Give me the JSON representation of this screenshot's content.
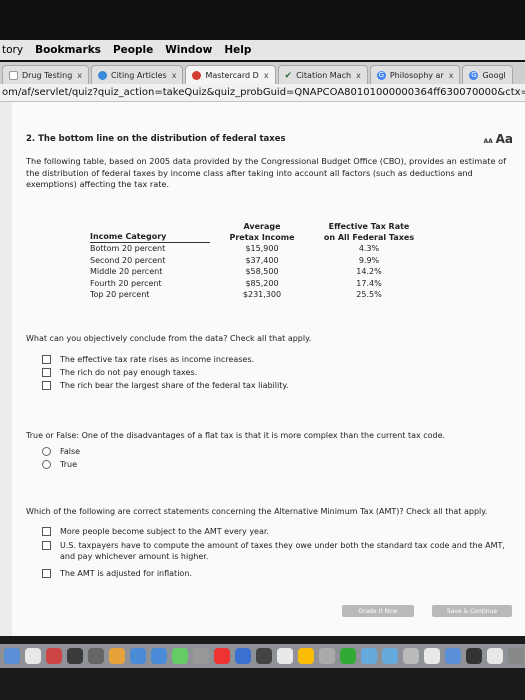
{
  "menubar": [
    "tory",
    "Bookmarks",
    "People",
    "Window",
    "Help"
  ],
  "tabs": [
    {
      "label": "Drug Testing",
      "close": "x",
      "icon_color": "#ffffff",
      "active": false
    },
    {
      "label": "Citing Articles",
      "close": "x",
      "icon_color": "#3b8ad9",
      "active": false
    },
    {
      "label": "Mastercard D",
      "close": "x",
      "icon_color": "#d33c2f",
      "active": true
    },
    {
      "label": "Citation Mach",
      "close": "x",
      "icon_color": "#2d6e3d",
      "active": false
    },
    {
      "label": "Philosophy ar",
      "close": "x",
      "icon_color": "#4285f4",
      "active": false
    },
    {
      "label": "Googl",
      "close": "",
      "icon_color": "#4285f4",
      "active": false
    }
  ],
  "address": "om/af/servlet/quiz?quiz_action=takeQuiz&quiz_probGuid=QNAPCOA80101000000364ff630070000&ctx=linnj-007",
  "question": {
    "title": "2. The bottom line on the distribution of federal taxes",
    "textsize": {
      "small": "AA",
      "large": "Aa"
    },
    "intro": "The following table, based on 2005 data provided by the Congressional Budget Office (CBO), provides an estimate of the distribution of federal taxes by income class after taking into account all factors (such as deductions and exemptions) affecting the tax rate."
  },
  "table": {
    "headers": [
      {
        "line1": "",
        "line2": "Income Category"
      },
      {
        "line1": "Average",
        "line2": "Pretax Income"
      },
      {
        "line1": "Effective Tax Rate",
        "line2": "on All Federal Taxes"
      }
    ],
    "rows": [
      [
        "Bottom 20 percent",
        "$15,900",
        "4.3%"
      ],
      [
        "Second 20 percent",
        "$37,400",
        "9.9%"
      ],
      [
        "Middle 20 percent",
        "$58,500",
        "14.2%"
      ],
      [
        "Fourth 20 percent",
        "$85,200",
        "17.4%"
      ],
      [
        "Top 20 percent",
        "$231,300",
        "25.5%"
      ]
    ]
  },
  "q1": {
    "prompt": "What can you objectively conclude from the data? Check all that apply.",
    "options": [
      "The effective tax rate rises as income increases.",
      "The rich do not pay enough taxes.",
      "The rich bear the largest share of the federal tax liability."
    ]
  },
  "q2": {
    "prompt": "True or False: One of the disadvantages of a flat tax is that it is more complex than the current tax code.",
    "options": [
      "False",
      "True"
    ]
  },
  "q3": {
    "prompt": "Which of the following are correct statements concerning the Alternative Minimum Tax (AMT)? Check all that apply.",
    "options": [
      "More people become subject to the AMT every year.",
      "U.S. taxpayers have to compute the amount of taxes they owe under both the standard tax code and the AMT, and pay whichever amount is higher.",
      "The AMT is adjusted for inflation."
    ]
  },
  "footer": {
    "grade_label": "Grade It Now",
    "save_label": "Save & Continue"
  },
  "dock_colors": [
    "#5a8fd8",
    "#e8e8e8",
    "#c44",
    "#3a3a3a",
    "#666",
    "#e5a23a",
    "#4a8ad6",
    "#4a8ad6",
    "#6c6",
    "#999",
    "#e33",
    "#3b6fd0",
    "#444",
    "#e9e9e9",
    "#fbbc05",
    "#aaa",
    "#3a3",
    "#6ad",
    "#6ad",
    "#bbb",
    "#e8e8e8",
    "#5a8fd8",
    "#333",
    "#e8e8e8",
    "#888"
  ]
}
